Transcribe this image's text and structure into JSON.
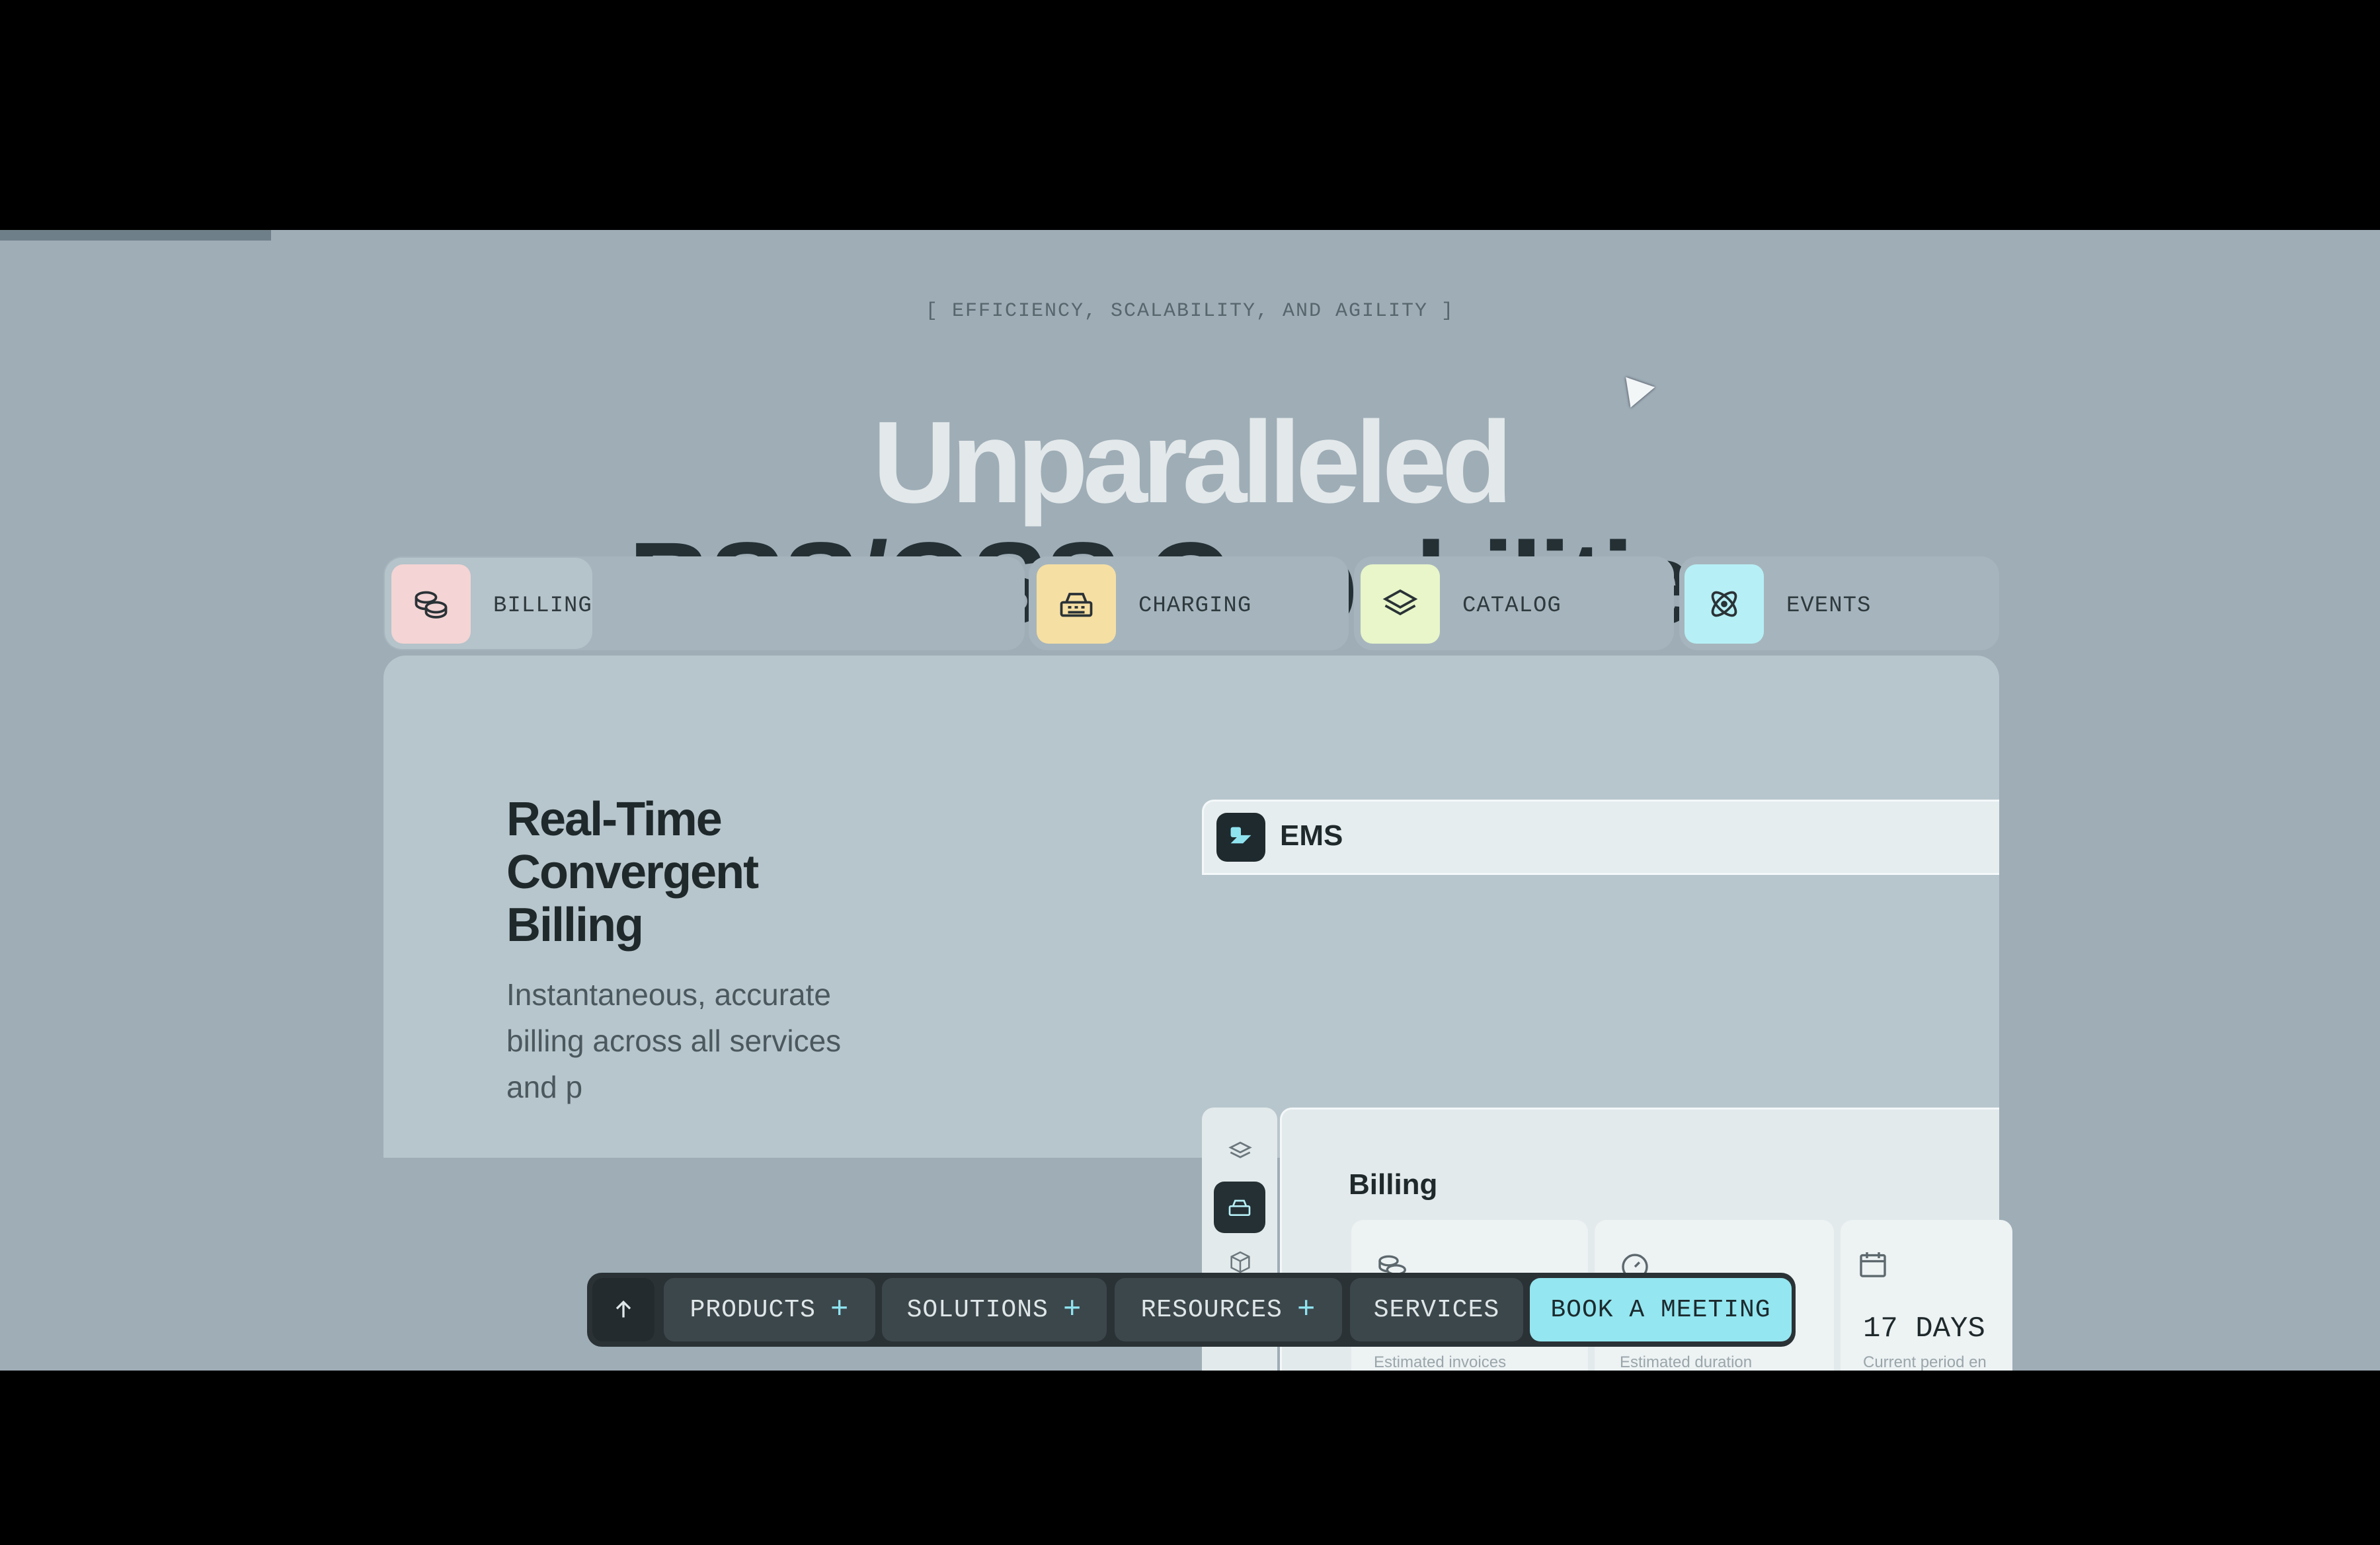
{
  "eyebrow": "[ EFFICIENCY, SCALABILITY, AND AGILITY ]",
  "headline": {
    "line1": "Unparalleled",
    "line2": "BSS/OSS Capabilities"
  },
  "tabs": [
    {
      "label": "BILLING",
      "icon": "coins-icon",
      "color": "#f4d4d4",
      "active": true
    },
    {
      "label": "CHARGING",
      "icon": "register-icon",
      "color": "#f6dfa3",
      "active": false
    },
    {
      "label": "CATALOG",
      "icon": "layers-icon",
      "color": "#e8f6c9",
      "active": false
    },
    {
      "label": "EVENTS",
      "icon": "atom-icon",
      "color": "#b6f0f6",
      "active": false
    }
  ],
  "panel": {
    "title": "Real-Time\nConvergent\nBilling",
    "description_lines": [
      "Instantaneous, accurate",
      "billing across all services",
      "and p"
    ]
  },
  "ems": {
    "title": "EMS",
    "section": "Billing",
    "cards": [
      {
        "icon": "coins-icon",
        "value": "",
        "caption": "Estimated invoices"
      },
      {
        "icon": "gauge-icon",
        "value": "",
        "caption": "Estimated duration"
      },
      {
        "icon": "calendar-icon",
        "value": "17 DAYS",
        "caption": "Current period en"
      }
    ]
  },
  "nav": {
    "items": [
      {
        "label": "PRODUCTS",
        "plus": "+"
      },
      {
        "label": "SOLUTIONS",
        "plus": "+"
      },
      {
        "label": "RESOURCES",
        "plus": "+"
      },
      {
        "label": "SERVICES",
        "plus": ""
      }
    ],
    "cta": "BOOK A MEETING",
    "accent": "#94e6f0"
  }
}
